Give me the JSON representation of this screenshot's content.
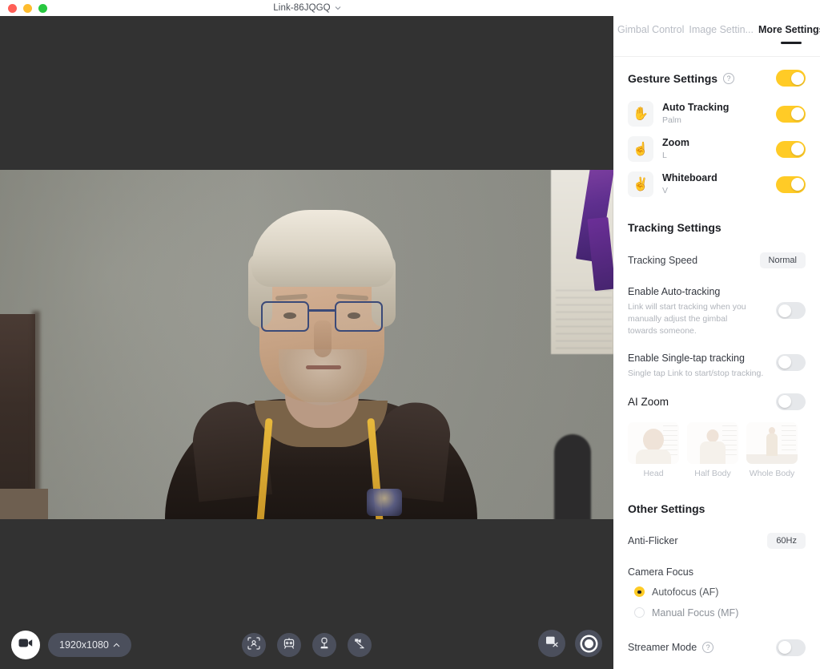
{
  "window": {
    "title": "Link-86JQGQ",
    "title_chevron": "chevron-down-icon",
    "traffic_lights": [
      "close",
      "minimize",
      "maximize"
    ],
    "header_icons": [
      "picture-in-picture-icon",
      "more-options-icon"
    ]
  },
  "video": {
    "resolution_label": "1920x1080",
    "resolution_chevron": "chevron-up-icon"
  },
  "toolbar": {
    "camera_icon": "camera-icon",
    "center_buttons": [
      {
        "icon": "face-tracking-icon",
        "name": "face-tracking-button"
      },
      {
        "icon": "gimbal-mode-icon",
        "name": "gimbal-mode-button"
      },
      {
        "icon": "gimbal-stand-icon",
        "name": "gimbal-stand-button"
      },
      {
        "icon": "whiteboard-mode-icon",
        "name": "whiteboard-mode-button"
      }
    ],
    "right_buttons": [
      {
        "icon": "snapshot-icon",
        "name": "snapshot-button"
      },
      {
        "icon": "record-icon",
        "name": "record-button"
      }
    ]
  },
  "sidebar": {
    "tabs": [
      {
        "label": "Gimbal Control",
        "active": false
      },
      {
        "label": "Image Settin...",
        "active": false
      },
      {
        "label": "More Settings",
        "active": true
      }
    ],
    "gesture_settings": {
      "title": "Gesture Settings",
      "help_icon": "help-icon",
      "enabled": true,
      "items": [
        {
          "icon": "palm-hand-icon",
          "glyph": "✋",
          "title": "Auto Tracking",
          "subtitle": "Palm",
          "enabled": true
        },
        {
          "icon": "pointing-up-hand-icon",
          "glyph": "☝",
          "title": "Zoom",
          "subtitle": "L",
          "enabled": true
        },
        {
          "icon": "victory-hand-icon",
          "glyph": "✌",
          "title": "Whiteboard",
          "subtitle": "V",
          "enabled": true
        }
      ]
    },
    "tracking_settings": {
      "title": "Tracking Settings",
      "tracking_speed": {
        "label": "Tracking Speed",
        "value": "Normal"
      },
      "auto_tracking": {
        "label": "Enable Auto-tracking",
        "description": "Link will start tracking when you manually adjust the gimbal towards someone.",
        "enabled": false
      },
      "single_tap": {
        "label": "Enable Single-tap tracking",
        "description": "Single tap Link to start/stop tracking.",
        "enabled": false
      },
      "ai_zoom": {
        "label": "AI Zoom",
        "enabled": false,
        "options": [
          {
            "label": "Head"
          },
          {
            "label": "Half Body"
          },
          {
            "label": "Whole Body"
          }
        ]
      }
    },
    "other_settings": {
      "title": "Other Settings",
      "anti_flicker": {
        "label": "Anti-Flicker",
        "value": "60Hz"
      },
      "camera_focus": {
        "label": "Camera Focus",
        "options": [
          {
            "label": "Autofocus (AF)",
            "selected": true
          },
          {
            "label": "Manual Focus (MF)",
            "selected": false
          }
        ]
      },
      "streamer_mode": {
        "label": "Streamer Mode",
        "help_icon": "help-icon",
        "enabled": false
      }
    }
  },
  "colors": {
    "accent": "#FFCB26",
    "toolbar_button": "#4B4F5C",
    "stage_background": "#323232"
  }
}
